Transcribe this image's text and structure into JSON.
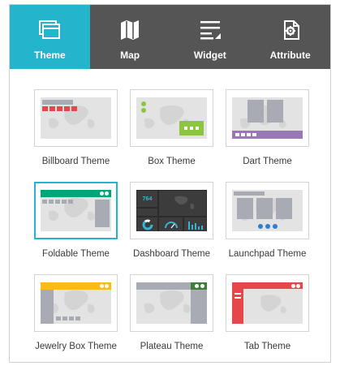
{
  "tabs": [
    {
      "label": "Theme",
      "icon": "theme-icon",
      "active": true
    },
    {
      "label": "Map",
      "icon": "map-icon",
      "active": false
    },
    {
      "label": "Widget",
      "icon": "widget-icon",
      "active": false
    },
    {
      "label": "Attribute",
      "icon": "attribute-icon",
      "active": false
    }
  ],
  "themes": [
    {
      "label": "Billboard Theme",
      "selected": false
    },
    {
      "label": "Box Theme",
      "selected": false
    },
    {
      "label": "Dart Theme",
      "selected": false
    },
    {
      "label": "Foldable Theme",
      "selected": true
    },
    {
      "label": "Dashboard Theme",
      "selected": false
    },
    {
      "label": "Launchpad Theme",
      "selected": false
    },
    {
      "label": "Jewelry Box Theme",
      "selected": false
    },
    {
      "label": "Plateau Theme",
      "selected": false
    },
    {
      "label": "Tab Theme",
      "selected": false
    }
  ],
  "dashboard": {
    "value": "764"
  },
  "colors": {
    "tab_active": "#24b5cc",
    "tab_bar": "#555555",
    "billboard": "#e5474b",
    "box": "#8cc63f",
    "dart": "#9a78b6",
    "foldable": "#00a57a",
    "dashboard": "#3c3c3c",
    "launchpad": "#2e7fd1",
    "jewelry": "#f6bd13",
    "plateau": "#3f7d3b",
    "tab": "#e5474b"
  }
}
